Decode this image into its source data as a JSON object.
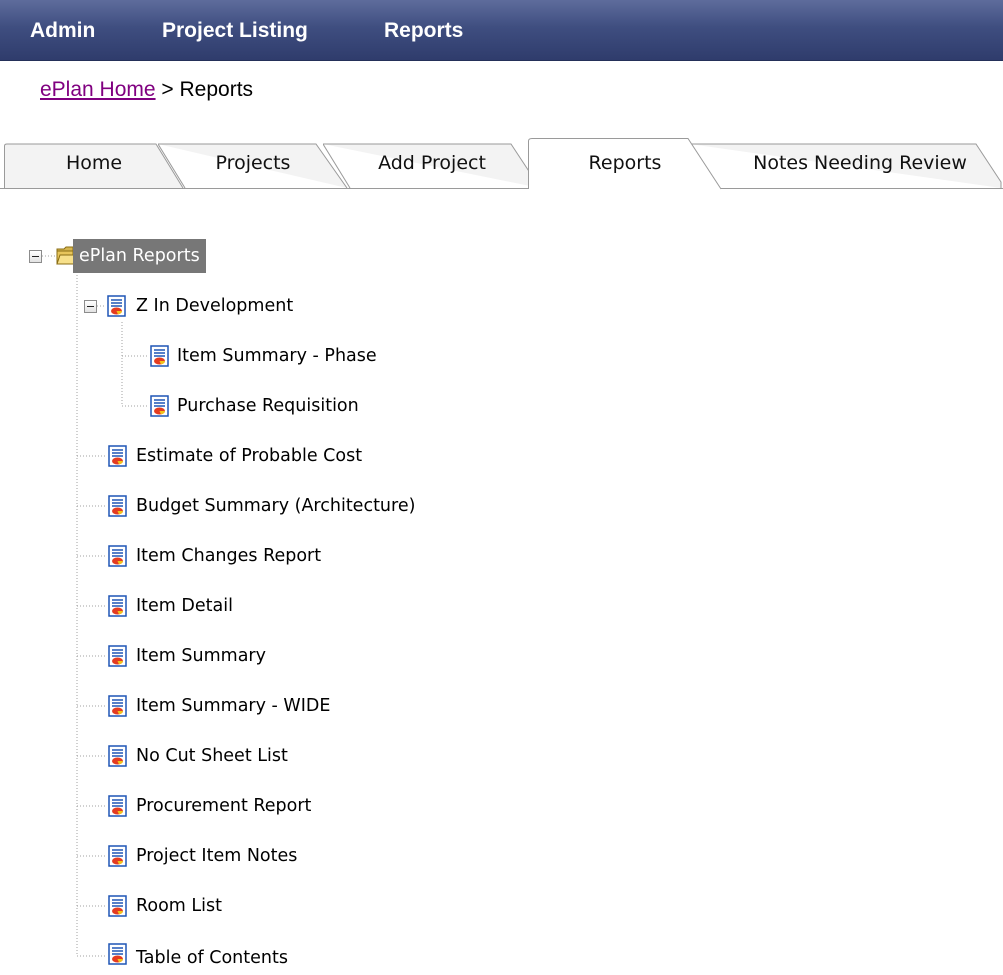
{
  "menubar": {
    "items": [
      "Admin",
      "Project Listing",
      "Reports"
    ]
  },
  "breadcrumb": {
    "home_link": "ePlan Home",
    "separator": " > ",
    "current": "Reports"
  },
  "tabs": {
    "items": [
      "Home",
      "Projects",
      "Add Project",
      "Reports",
      "Notes Needing Review"
    ],
    "active": "Reports"
  },
  "tree": {
    "root": "ePlan Reports",
    "folder": "Z In Development",
    "folder_children": [
      "Item Summary - Phase",
      "Purchase Requisition"
    ],
    "reports": [
      "Estimate of Probable Cost",
      "Budget Summary (Architecture)",
      "Item Changes Report",
      "Item Detail",
      "Item Summary",
      "Item Summary - WIDE",
      "No Cut Sheet List",
      "Procurement Report",
      "Project Item Notes",
      "Room List",
      "Table of Contents"
    ]
  },
  "colors": {
    "menubar": "#3f4e80",
    "visited_link": "#800080",
    "root_highlight": "#777777"
  }
}
